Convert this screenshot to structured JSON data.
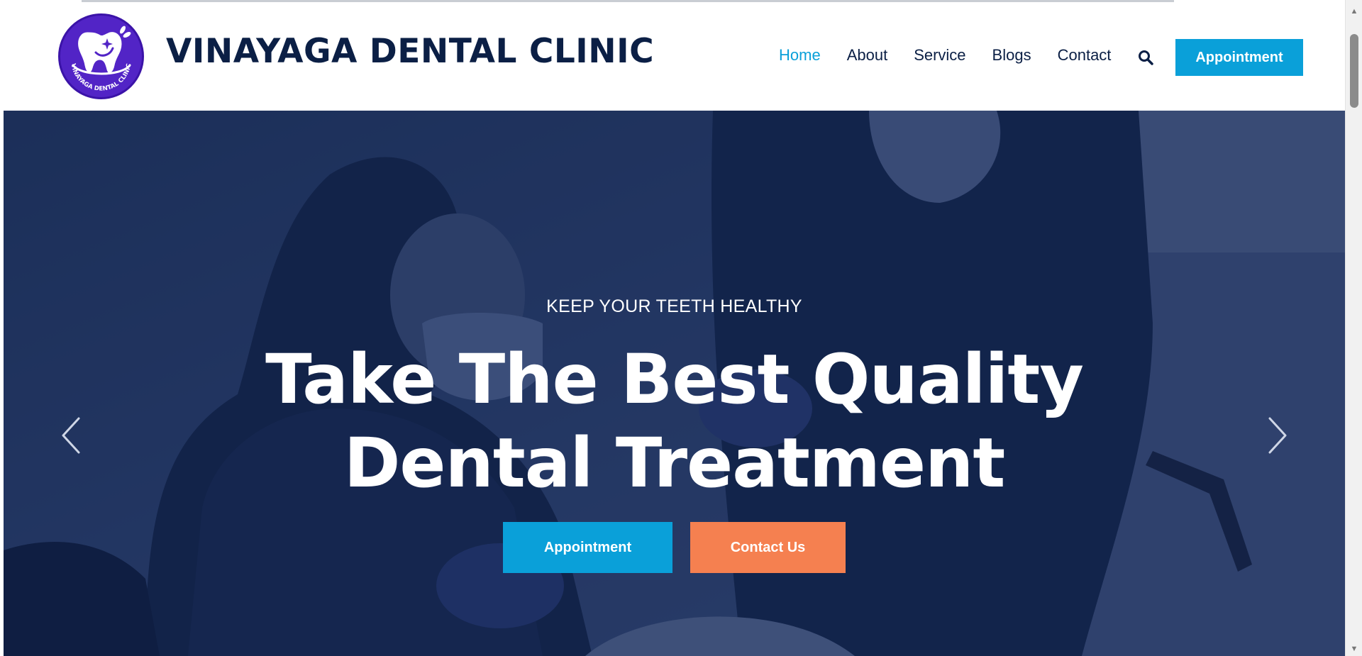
{
  "brand": {
    "name": "VINAYAGA DENTAL CLINIC",
    "logo_text": "VINAYAGA DENTAL CLINIC"
  },
  "nav": {
    "items": [
      {
        "label": "Home",
        "active": true
      },
      {
        "label": "About",
        "active": false
      },
      {
        "label": "Service",
        "active": false
      },
      {
        "label": "Blogs",
        "active": false
      },
      {
        "label": "Contact",
        "active": false
      }
    ],
    "search_icon": "search-icon",
    "appointment_label": "Appointment"
  },
  "hero": {
    "kicker": "KEEP YOUR TEETH HEALTHY",
    "title_line1": "Take The Best Quality",
    "title_line2": "Dental Treatment",
    "primary_button": "Appointment",
    "secondary_button": "Contact Us",
    "prev_icon": "chevron-left-icon",
    "next_icon": "chevron-right-icon"
  },
  "colors": {
    "accent": "#0aa0d9",
    "secondary": "#f58050",
    "brand_text": "#0b1f45",
    "logo_bg": "#5224c6"
  }
}
